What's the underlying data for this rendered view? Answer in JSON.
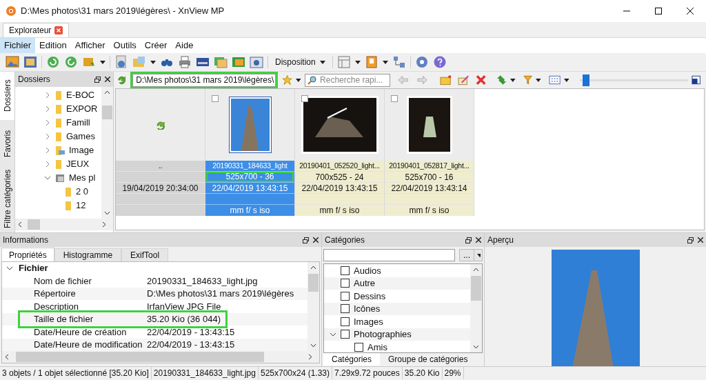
{
  "window": {
    "title": "D:\\Mes photos\\31 mars 2019\\légères\\ - XnView MP"
  },
  "tabs": [
    {
      "label": "Explorateur",
      "selected": true
    }
  ],
  "menu": [
    {
      "label": "Fichier",
      "selected": true
    },
    {
      "label": "Edition",
      "selected": false
    },
    {
      "label": "Afficher",
      "selected": false
    },
    {
      "label": "Outils",
      "selected": false
    },
    {
      "label": "Créer",
      "selected": false
    },
    {
      "label": "Aide",
      "selected": false
    }
  ],
  "toolbar": {
    "layout_label": "Disposition"
  },
  "address_bar": {
    "value": "D:\\Mes photos\\31 mars 2019\\légères\\",
    "highlighted": true
  },
  "search": {
    "placeholder": "Recherche rapi..."
  },
  "zoom_slider": {
    "level": 0.03
  },
  "side_tabs": [
    {
      "label": "Dossiers",
      "selected": true
    },
    {
      "label": "Favoris",
      "selected": false
    },
    {
      "label": "Filtre catégories",
      "selected": false
    }
  ],
  "folders_panel": {
    "title": "Dossiers",
    "tree": [
      {
        "label": "E-BOC",
        "kind": "folder",
        "expanded": false
      },
      {
        "label": "EXPOR",
        "kind": "folder",
        "expanded": false
      },
      {
        "label": "Famill",
        "kind": "folder",
        "expanded": false
      },
      {
        "label": "Games",
        "kind": "folder",
        "expanded": false
      },
      {
        "label": "Image",
        "kind": "pictures",
        "expanded": false
      },
      {
        "label": "JEUX",
        "kind": "folder",
        "expanded": false
      },
      {
        "label": "Mes pl",
        "kind": "photos",
        "expanded": true,
        "children": [
          {
            "label": "2 0",
            "kind": "folder"
          },
          {
            "label": "12",
            "kind": "folder"
          }
        ]
      }
    ]
  },
  "thumbnails": [
    {
      "kind": "parent",
      "selected": false,
      "name": "..",
      "date": "19/04/2019 20:34:00"
    },
    {
      "kind": "image",
      "selected": true,
      "checked": false,
      "name": "20190331_184633_light",
      "dims": "525x700 - 36",
      "dims_highlighted": true,
      "date": "22/04/2019 13:43:15",
      "exif": "mm f/ s iso"
    },
    {
      "kind": "image",
      "selected": false,
      "checked": false,
      "name": "20190401_052520_light...",
      "dims": "700x525 - 24",
      "dims_highlighted": false,
      "date": "22/04/2019 13:43:15",
      "exif": "mm f/ s iso"
    },
    {
      "kind": "image",
      "selected": false,
      "checked": false,
      "name": "20190401_052817_light...",
      "dims": "525x700 - 16",
      "dims_highlighted": false,
      "date": "22/04/2019 13:43:14",
      "exif": "mm f/ s iso"
    }
  ],
  "info_panel": {
    "title": "Informations",
    "tabs": [
      {
        "label": "Propriétés",
        "selected": true
      },
      {
        "label": "Histogramme",
        "selected": false
      },
      {
        "label": "ExifTool",
        "selected": false
      }
    ],
    "groups": [
      {
        "label": "Fichier",
        "expanded": true,
        "rows": [
          {
            "name": "Nom de fichier",
            "value": "20190331_184633_light.jpg",
            "highlighted": false
          },
          {
            "name": "Répertoire",
            "value": "D:\\Mes photos\\31 mars 2019\\légères",
            "highlighted": false
          },
          {
            "name": "Description",
            "value": "IrfanView JPG File",
            "highlighted": false
          },
          {
            "name": "Taille de fichier",
            "value": "35.20 Kio (36 044)",
            "highlighted": true
          },
          {
            "name": "Date/Heure de création",
            "value": "22/04/2019 - 13:43:15",
            "highlighted": false
          },
          {
            "name": "Date/Heure de modification",
            "value": "22/04/2019 - 13:43:15",
            "highlighted": false
          }
        ]
      }
    ]
  },
  "categories_panel": {
    "title": "Catégories",
    "more_button": "...",
    "items": [
      {
        "label": "Audios",
        "checked": false
      },
      {
        "label": "Autre",
        "checked": false
      },
      {
        "label": "Dessins",
        "checked": false
      },
      {
        "label": "Icônes",
        "checked": false
      },
      {
        "label": "Images",
        "checked": false
      },
      {
        "label": "Photographies",
        "checked": false,
        "expanded": true,
        "children": [
          {
            "label": "Amis",
            "checked": false
          }
        ]
      }
    ],
    "tabs": [
      {
        "label": "Catégories",
        "selected": true
      },
      {
        "label": "Groupe de catégories",
        "selected": false
      }
    ]
  },
  "preview_panel": {
    "title": "Aperçu"
  },
  "status_bar": [
    "3 objets / 1 objet sélectionné [35.20 Kio]",
    "20190331_184633_light.jpg",
    "525x700x24 (1.33)",
    "7.29x9.72 pouces",
    "35.20 Kio",
    "29%"
  ]
}
